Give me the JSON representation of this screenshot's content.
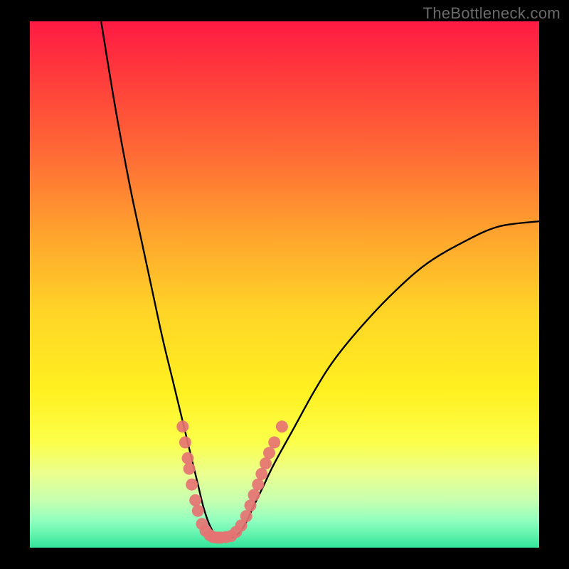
{
  "watermark": "TheBottleneck.com",
  "chart_data": {
    "type": "line",
    "title": "",
    "xlabel": "",
    "ylabel": "",
    "xlim": [
      0,
      100
    ],
    "ylim": [
      0,
      100
    ],
    "series": [
      {
        "name": "curve",
        "x": [
          14,
          16,
          18,
          20,
          22,
          24,
          26,
          28,
          30,
          32,
          33,
          34,
          35,
          36,
          37,
          38,
          40,
          42,
          44,
          46,
          48,
          52,
          56,
          60,
          66,
          72,
          78,
          85,
          92,
          100
        ],
        "y": [
          100,
          88,
          77,
          67,
          58,
          49,
          40,
          32,
          24,
          16,
          12,
          8,
          5,
          3,
          2,
          2,
          2,
          4,
          8,
          12,
          16,
          23,
          30,
          36,
          43,
          49,
          54,
          58,
          61,
          62
        ]
      }
    ],
    "markers": {
      "name": "dots",
      "points": [
        {
          "x": 30.0,
          "y": 23
        },
        {
          "x": 30.5,
          "y": 20
        },
        {
          "x": 31.0,
          "y": 17
        },
        {
          "x": 31.3,
          "y": 15
        },
        {
          "x": 31.8,
          "y": 12
        },
        {
          "x": 32.5,
          "y": 9
        },
        {
          "x": 33.0,
          "y": 7
        },
        {
          "x": 33.8,
          "y": 4.5
        },
        {
          "x": 34.5,
          "y": 3.2
        },
        {
          "x": 35.3,
          "y": 2.4
        },
        {
          "x": 36.0,
          "y": 2.0
        },
        {
          "x": 36.8,
          "y": 1.9
        },
        {
          "x": 37.5,
          "y": 1.9
        },
        {
          "x": 38.5,
          "y": 2.0
        },
        {
          "x": 39.5,
          "y": 2.2
        },
        {
          "x": 40.5,
          "y": 3.0
        },
        {
          "x": 41.5,
          "y": 4.2
        },
        {
          "x": 42.5,
          "y": 6.0
        },
        {
          "x": 43.3,
          "y": 8.0
        },
        {
          "x": 44.0,
          "y": 10.0
        },
        {
          "x": 44.8,
          "y": 12.0
        },
        {
          "x": 45.5,
          "y": 14.0
        },
        {
          "x": 46.3,
          "y": 16.0
        },
        {
          "x": 47.0,
          "y": 18.0
        },
        {
          "x": 48.0,
          "y": 20.0
        },
        {
          "x": 49.5,
          "y": 23.0
        }
      ]
    },
    "gradient_stops": [
      {
        "pos": 0,
        "color": "#ff1a44"
      },
      {
        "pos": 10,
        "color": "#ff3a3c"
      },
      {
        "pos": 25,
        "color": "#ff6a36"
      },
      {
        "pos": 40,
        "color": "#ffa22e"
      },
      {
        "pos": 55,
        "color": "#ffd427"
      },
      {
        "pos": 70,
        "color": "#fff020"
      },
      {
        "pos": 80,
        "color": "#fcff4a"
      },
      {
        "pos": 86,
        "color": "#eaff8f"
      },
      {
        "pos": 91,
        "color": "#c7ffb0"
      },
      {
        "pos": 95,
        "color": "#8fffc0"
      },
      {
        "pos": 100,
        "color": "#33e59a"
      }
    ],
    "marker_color": "#e57373",
    "curve_color": "#000000"
  }
}
